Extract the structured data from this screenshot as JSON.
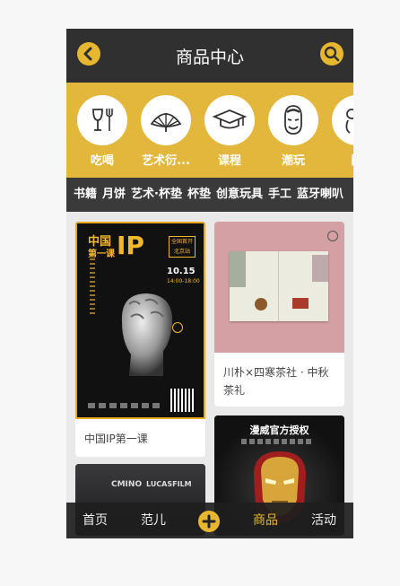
{
  "header": {
    "title": "商品中心",
    "back_icon": "chevron-left-icon",
    "search_icon": "search-icon"
  },
  "categories": [
    {
      "label": "吃喝",
      "icon": "wine-fork-icon"
    },
    {
      "label": "艺术衍...",
      "icon": "fan-icon"
    },
    {
      "label": "课程",
      "icon": "graduation-cap-icon"
    },
    {
      "label": "潮玩",
      "icon": "mask-face-icon"
    },
    {
      "label": "配",
      "icon": "ring-icon"
    }
  ],
  "tags": [
    "书籍",
    "月饼",
    "艺术·杯垫",
    "杯垫",
    "创意玩具",
    "手工",
    "蓝牙喇叭"
  ],
  "products": [
    {
      "caption": "中国IP第一课",
      "poster": {
        "title_line1": "中国",
        "title_line2": "第一课",
        "big": "IP",
        "badge_line1": "全国首开",
        "badge_line2": "北京站",
        "date": "10.15",
        "time": "14:00-18:00"
      }
    },
    {
      "caption": "川朴×四寒茶社 · 中秋茶礼"
    },
    {
      "caption": "",
      "brand1": "CMINO",
      "brand2": "LUCASFILM"
    },
    {
      "caption": "",
      "banner": "漫威官方授权"
    }
  ],
  "nav": {
    "items": [
      "首页",
      "范儿",
      "商品",
      "活动"
    ],
    "active": "商品"
  },
  "colors": {
    "accent": "#e8b730",
    "header": "#303030",
    "strip": "#e3b73c"
  }
}
